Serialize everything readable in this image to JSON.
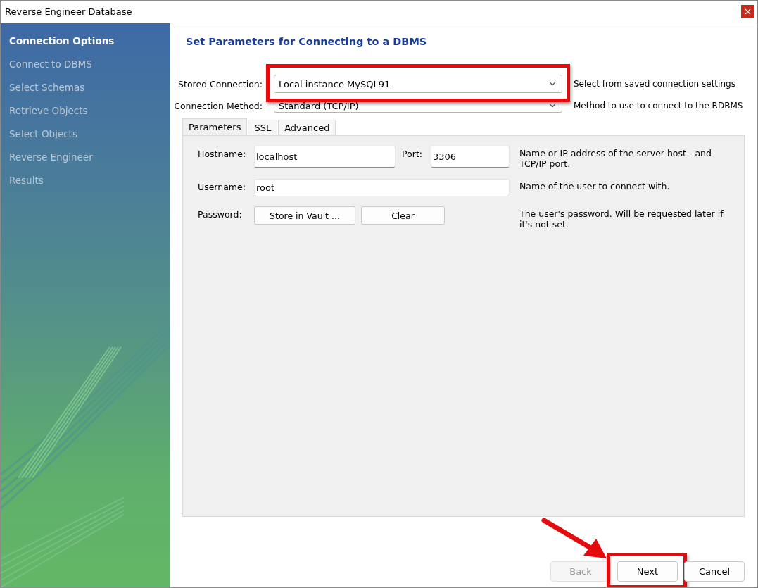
{
  "window": {
    "title": "Reverse Engineer Database"
  },
  "sidebar": {
    "items": [
      {
        "label": "Connection Options",
        "selected": true
      },
      {
        "label": "Connect to DBMS",
        "selected": false
      },
      {
        "label": "Select Schemas",
        "selected": false
      },
      {
        "label": "Retrieve Objects",
        "selected": false
      },
      {
        "label": "Select Objects",
        "selected": false
      },
      {
        "label": "Reverse Engineer",
        "selected": false
      },
      {
        "label": "Results",
        "selected": false
      }
    ]
  },
  "heading": "Set Parameters for Connecting to a DBMS",
  "stored_connection": {
    "label": "Stored Connection:",
    "value": "Local instance MySQL91",
    "hint": "Select from saved connection settings",
    "highlighted": true
  },
  "connection_method": {
    "label": "Connection Method:",
    "value": "Standard (TCP/IP)",
    "hint": "Method to use to connect to the RDBMS"
  },
  "tabs": [
    {
      "label": "Parameters",
      "selected": true
    },
    {
      "label": "SSL",
      "selected": false
    },
    {
      "label": "Advanced",
      "selected": false
    }
  ],
  "parameters": {
    "hostname": {
      "label": "Hostname:",
      "value": "localhost"
    },
    "port": {
      "label": "Port:",
      "value": "3306"
    },
    "hostname_hint": "Name or IP address of the server host - and TCP/IP port.",
    "username": {
      "label": "Username:",
      "value": "root",
      "hint": "Name of the user to connect with."
    },
    "password": {
      "label": "Password:",
      "buttons": [
        "Store in Vault ...",
        "Clear"
      ],
      "hint": "The user's password. Will be requested later if it's not set."
    }
  },
  "buttons": [
    {
      "label": "Back",
      "disabled": true,
      "highlighted": false
    },
    {
      "label": "Next",
      "disabled": false,
      "highlighted": true
    },
    {
      "label": "Cancel",
      "disabled": false,
      "highlighted": false
    }
  ]
}
